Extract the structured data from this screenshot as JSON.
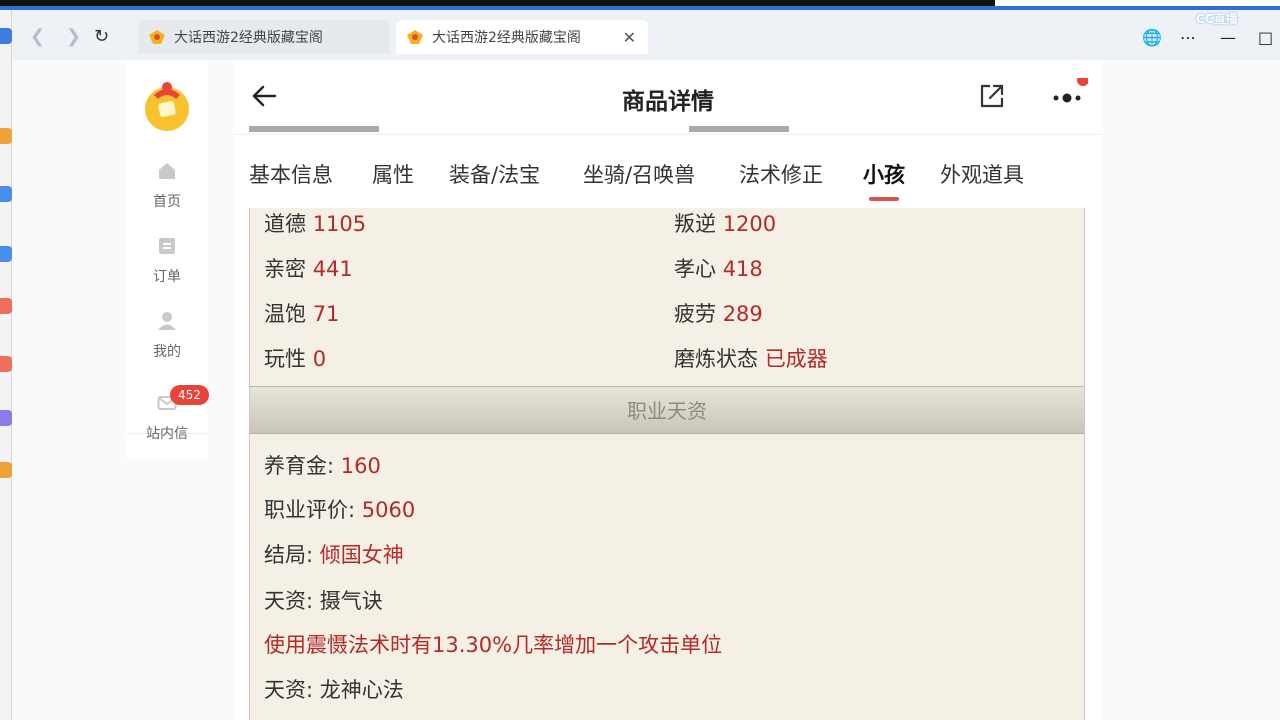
{
  "browser": {
    "tabs": [
      {
        "label": "大话西游2经典版藏宝阁",
        "active": false
      },
      {
        "label": "大话西游2经典版藏宝阁",
        "active": true
      }
    ],
    "overlay_logo": "CC直播"
  },
  "sidenav": {
    "items": [
      {
        "label": "首页",
        "icon": "home-icon"
      },
      {
        "label": "订单",
        "icon": "order-icon"
      },
      {
        "label": "我的",
        "icon": "user-icon"
      },
      {
        "label": "站内信",
        "icon": "message-icon"
      }
    ],
    "message_badge": "452"
  },
  "header": {
    "title": "商品详情"
  },
  "subtabs": [
    {
      "label": "基本信息"
    },
    {
      "label": "属性"
    },
    {
      "label": "装备/法宝"
    },
    {
      "label": "坐骑/召唤兽"
    },
    {
      "label": "法术修正"
    },
    {
      "label": "小孩",
      "active": true
    },
    {
      "label": "外观道具"
    }
  ],
  "attributes": [
    {
      "label": "道德",
      "value": "1105"
    },
    {
      "label": "叛逆",
      "value": "1200"
    },
    {
      "label": "亲密",
      "value": "441"
    },
    {
      "label": "孝心",
      "value": "418"
    },
    {
      "label": "温饱",
      "value": "71"
    },
    {
      "label": "疲劳",
      "value": "289"
    },
    {
      "label": "玩性",
      "value": "0"
    },
    {
      "label": "磨炼状态",
      "value": "已成器"
    }
  ],
  "career": {
    "section_title": "职业天资",
    "rows": [
      {
        "label": "养育金: ",
        "value": "160"
      },
      {
        "label": "职业评价: ",
        "value": "5060"
      },
      {
        "label": "结局: ",
        "value": "倾国女神"
      },
      {
        "label": "天资: ",
        "value": "摄气诀"
      }
    ],
    "effect": "使用震慑法术时有13.30%几率增加一个攻击单位",
    "talent2": {
      "label": "天资: ",
      "value": "龙神心法"
    }
  },
  "colors": {
    "accent": "#d9534f",
    "value_red": "#b42a25",
    "panel_bg": "#f4f0e6"
  }
}
